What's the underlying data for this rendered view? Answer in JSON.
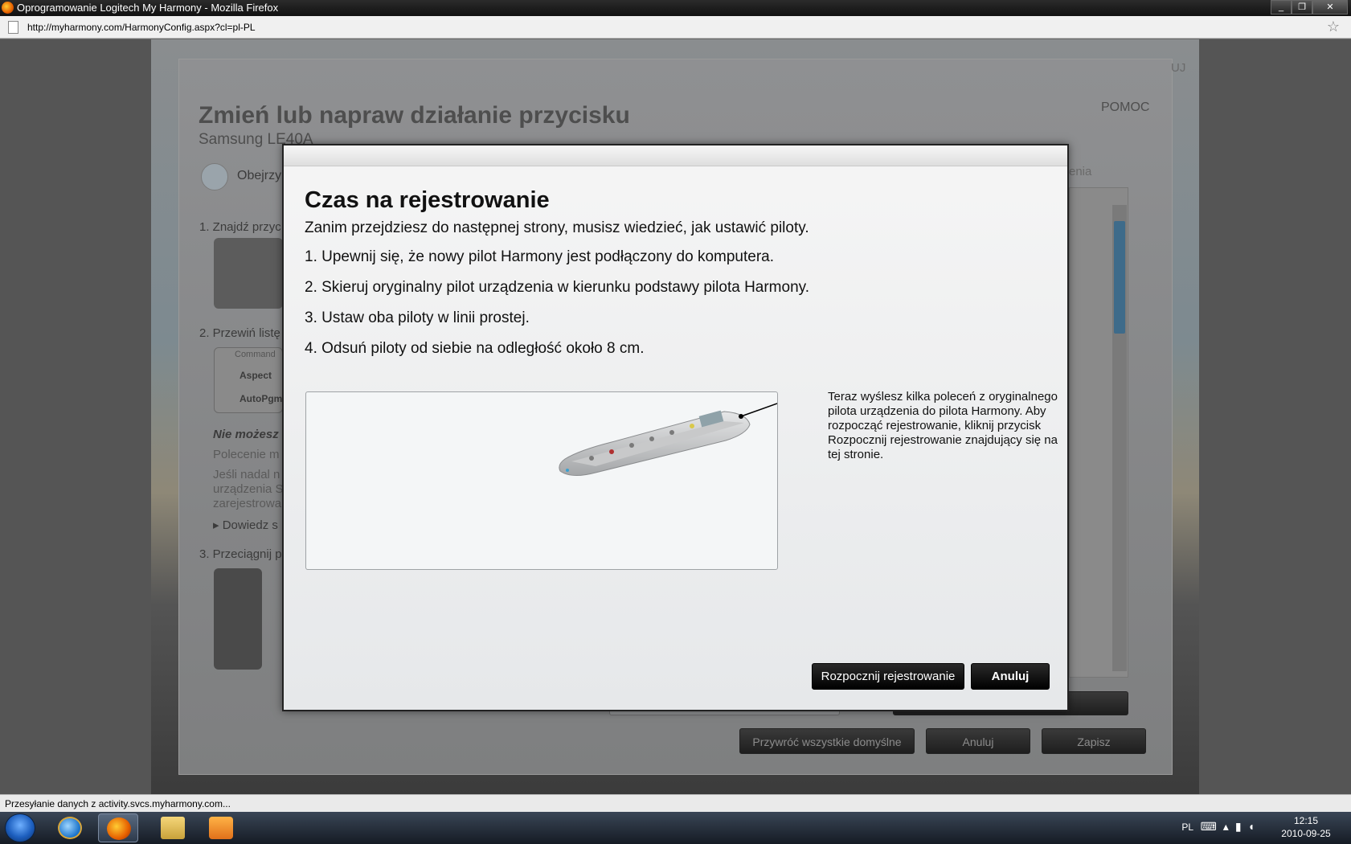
{
  "window": {
    "title": "Oprogramowanie Logitech My Harmony - Mozilla Firefox",
    "controls": [
      "_",
      "❐",
      "✕"
    ]
  },
  "browser": {
    "url": "http://myharmony.com/HarmonyConfig.aspx?cl=pl-PL",
    "status": "Przesyłanie danych z activity.svcs.myharmony.com..."
  },
  "background_page": {
    "title": "Zmień lub napraw działanie przycisku",
    "subtitle": "Samsung LE40A",
    "help": "POMOC",
    "corner_fragment": "UJ",
    "right_fragment": "enia",
    "watch_fragment": "Obejrzy",
    "step1": "1. Znajdź przyc",
    "step2": "2. Przewiń listę",
    "list_header": "Command",
    "list_items": [
      "Aspect",
      "AutoPgm"
    ],
    "warning": "Nie możesz",
    "line1": "Polecenie m",
    "line2": "Jeśli nadal n",
    "line3": "urządzenia S",
    "line4": "zarejestrowa",
    "link": "▸ Dowiedz s",
    "step3": "3. Przeciągnij p",
    "buttons": {
      "restore": "Przywróć wszystkie domyślne",
      "cancel": "Anuluj",
      "save": "Zapisz"
    }
  },
  "modal": {
    "title": "Czas na rejestrowanie",
    "intro": "Zanim przejdziesz do następnej strony, musisz wiedzieć, jak ustawić piloty.",
    "steps": [
      "1. Upewnij się, że nowy pilot Harmony jest podłączony do komputera.",
      "2. Skieruj oryginalny pilot urządzenia w kierunku podstawy pilota Harmony.",
      "3. Ustaw oba piloty w linii prostej.",
      "4. Odsuń piloty od siebie na odległość około 8 cm."
    ],
    "info": "Teraz wyślesz kilka poleceń z oryginalnego pilota urządzenia do pilota Harmony. Aby rozpocząć rejestrowanie, kliknij przycisk Rozpocznij rejestrowanie znajdujący się na tej stronie.",
    "buttons": {
      "start": "Rozpocznij rejestrowanie",
      "cancel": "Anuluj"
    }
  },
  "taskbar": {
    "language": "PL",
    "time": "12:15",
    "date": "2010-09-25",
    "tray_icons": [
      "keyboard-icon",
      "show-hidden-icon",
      "network-icon",
      "volume-icon"
    ]
  }
}
